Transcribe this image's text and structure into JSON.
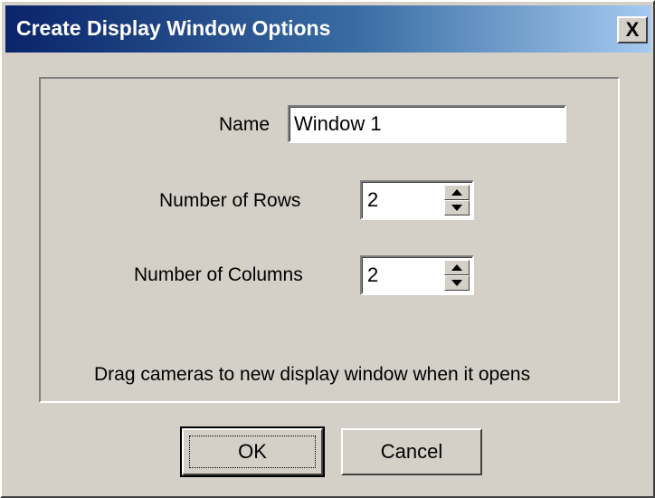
{
  "window": {
    "title": "Create Display Window Options",
    "close_label": "X"
  },
  "form": {
    "name_label": "Name",
    "name_value": "Window 1",
    "rows_label": "Number of Rows",
    "rows_value": "2",
    "columns_label": "Number of Columns",
    "columns_value": "2",
    "hint": "Drag cameras to new display window when it opens"
  },
  "buttons": {
    "ok_label": "OK",
    "cancel_label": "Cancel"
  },
  "colors": {
    "face": "#d4d0c8",
    "title_start": "#0a246a",
    "title_end": "#a6caf0"
  },
  "icons": {
    "close": "close-icon",
    "spin_up": "arrow-up-icon",
    "spin_down": "arrow-down-icon"
  }
}
